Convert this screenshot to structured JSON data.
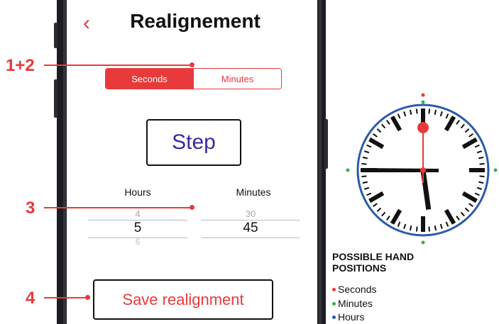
{
  "header": {
    "title": "Realignement",
    "back_icon": "chevron-left-icon"
  },
  "segment": {
    "options": [
      "Seconds",
      "Minutes"
    ],
    "selected": "Seconds"
  },
  "step_button": {
    "label": "Step"
  },
  "pickers": {
    "hours": {
      "label": "Hours",
      "prev": "4",
      "value": "5",
      "next": "6"
    },
    "minutes": {
      "label": "Minutes",
      "prev": "30",
      "value": "45",
      "next": ""
    }
  },
  "save_button": {
    "label": "Save realignment"
  },
  "callouts": [
    "1+2",
    "3",
    "4"
  ],
  "legend": {
    "title": "POSSIBLE HAND POSITIONS",
    "items": [
      {
        "label": "Seconds",
        "color": "#e83a3a"
      },
      {
        "label": "Minutes",
        "color": "#3cb043"
      },
      {
        "label": "Hours",
        "color": "#2b5aa8"
      }
    ]
  },
  "colors": {
    "accent": "#e83a3a",
    "step_text": "#3a2b9a",
    "clock_rim": "#2b5aa8",
    "minute_dot": "#3cb043"
  }
}
